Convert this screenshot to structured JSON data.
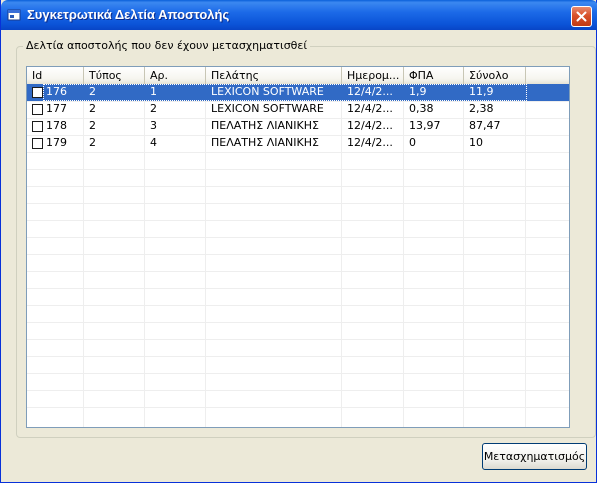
{
  "window": {
    "title": "Συγκετρωτικά Δελτία Αποστολής"
  },
  "group": {
    "legend": "Δελτία αποστολής που δεν έχουν μετασχηματισθεί"
  },
  "table": {
    "columns": [
      "Id",
      "Τύπος",
      "Αρ.",
      "Πελάτης",
      "Ημερομ...",
      "ΦΠΑ",
      "Σύνολο"
    ],
    "rows": [
      {
        "id": "176",
        "type": "2",
        "num": "1",
        "customer": "LEXICON SOFTWARE",
        "date": "12/4/2...",
        "vat": "1,9",
        "total": "11,9",
        "selected": true
      },
      {
        "id": "177",
        "type": "2",
        "num": "2",
        "customer": "LEXICON SOFTWARE",
        "date": "12/4/2...",
        "vat": "0,38",
        "total": "2,38",
        "selected": false
      },
      {
        "id": "178",
        "type": "2",
        "num": "3",
        "customer": "ΠΕΛΑΤΗΣ ΛΙΑΝΙΚΗΣ",
        "date": "12/4/2...",
        "vat": "13,97",
        "total": "87,47",
        "selected": false
      },
      {
        "id": "179",
        "type": "2",
        "num": "4",
        "customer": "ΠΕΛΑΤΗΣ ΛΙΑΝΙΚΗΣ",
        "date": "12/4/2...",
        "vat": "0",
        "total": "10",
        "selected": false
      }
    ]
  },
  "buttons": {
    "transform_label": "Μετασχηματισμός"
  },
  "colors": {
    "title_bar": "#0b54d8",
    "selection": "#316ac5",
    "window_bg": "#ece9d8"
  }
}
